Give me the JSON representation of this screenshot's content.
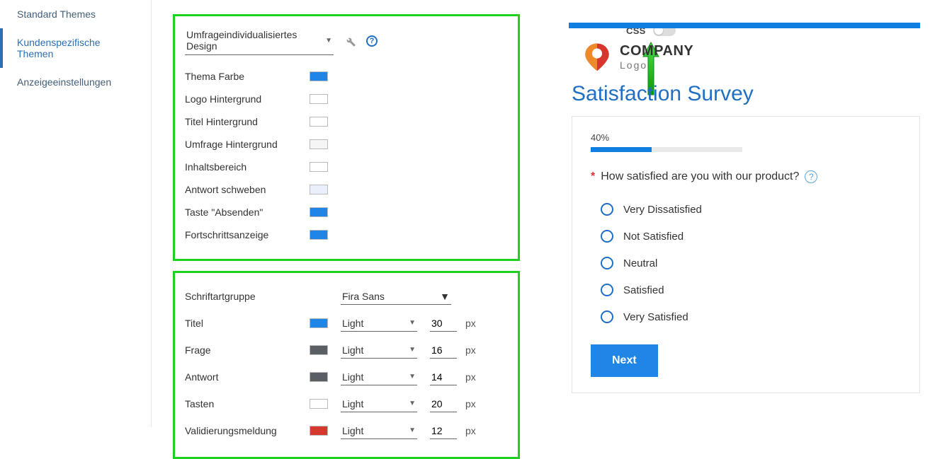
{
  "sidebar": {
    "items": [
      {
        "label": "Standard Themes"
      },
      {
        "label": "Kundenspezifische Themen"
      },
      {
        "label": "Anzeigeeinstellungen"
      }
    ]
  },
  "design": {
    "dropdown": "Umfrageindividualisiertes Design",
    "rows": [
      {
        "label": "Thema Farbe",
        "color": "#1f86e8"
      },
      {
        "label": "Logo Hintergrund",
        "color": "#ffffff"
      },
      {
        "label": "Titel Hintergrund",
        "color": "#ffffff"
      },
      {
        "label": "Umfrage Hintergrund",
        "color": "#f5f5f5"
      },
      {
        "label": "Inhaltsbereich",
        "color": "#ffffff"
      },
      {
        "label": "Antwort schweben",
        "color": "#e8f1fb"
      },
      {
        "label": "Taste \"Absenden\"",
        "color": "#1f86e8"
      },
      {
        "label": "Fortschrittsanzeige",
        "color": "#1f86e8"
      }
    ]
  },
  "fonts": {
    "family_label": "Schriftartgruppe",
    "family_value": "Fira Sans",
    "rows": [
      {
        "label": "Titel",
        "color": "#1f86e8",
        "weight": "Light",
        "size": "30",
        "unit": "px"
      },
      {
        "label": "Frage",
        "color": "#5a5f66",
        "weight": "Light",
        "size": "16",
        "unit": "px"
      },
      {
        "label": "Antwort",
        "color": "#5a5f66",
        "weight": "Light",
        "size": "14",
        "unit": "px"
      },
      {
        "label": "Tasten",
        "color": "#ffffff",
        "weight": "Light",
        "size": "20",
        "unit": "px"
      },
      {
        "label": "Validierungsmeldung",
        "color": "#d63a2f",
        "weight": "Light",
        "size": "12",
        "unit": "px"
      }
    ]
  },
  "css_toggle": {
    "label": "CSS",
    "on": false
  },
  "preview": {
    "logo": {
      "main": "COMPANY",
      "sub": "Logo"
    },
    "title": "Satisfaction Survey",
    "progress": {
      "label": "40%",
      "value": 40
    },
    "question": "How satisfied are you with our product?",
    "options": [
      "Very Dissatisfied",
      "Not Satisfied",
      "Neutral",
      "Satisfied",
      "Very Satisfied"
    ],
    "next": "Next"
  }
}
